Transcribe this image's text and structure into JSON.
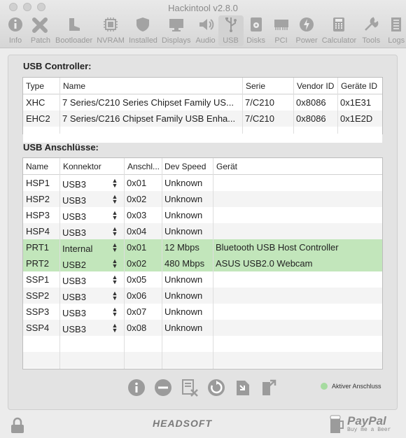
{
  "window": {
    "title": "Hackintool v2.8.0"
  },
  "toolbar": [
    {
      "label": "Info",
      "icon": "info-icon"
    },
    {
      "label": "Patch",
      "icon": "patch-icon"
    },
    {
      "label": "Bootloader",
      "icon": "boot-icon"
    },
    {
      "label": "NVRAM",
      "icon": "chip-icon"
    },
    {
      "label": "Installed",
      "icon": "shield-icon"
    },
    {
      "label": "Displays",
      "icon": "display-icon"
    },
    {
      "label": "Audio",
      "icon": "speaker-icon"
    },
    {
      "label": "USB",
      "icon": "usb-icon",
      "active": true
    },
    {
      "label": "Disks",
      "icon": "disk-icon"
    },
    {
      "label": "PCI",
      "icon": "pci-icon"
    },
    {
      "label": "Power",
      "icon": "power-icon"
    },
    {
      "label": "Calculator",
      "icon": "calculator-icon"
    },
    {
      "label": "Tools",
      "icon": "tools-icon"
    },
    {
      "label": "Logs",
      "icon": "logs-icon"
    }
  ],
  "controller": {
    "title": "USB Controller:",
    "headers": {
      "type": "Type",
      "name": "Name",
      "serie": "Serie",
      "vendor": "Vendor ID",
      "device": "Geräte ID"
    },
    "rows": [
      {
        "type": "XHC",
        "name": "7 Series/C210 Series Chipset Family US...",
        "serie": "7/C210",
        "vendor": "0x8086",
        "device": "0x1E31"
      },
      {
        "type": "EHC2",
        "name": "7 Series/C216 Chipset Family USB Enha...",
        "serie": "7/C210",
        "vendor": "0x8086",
        "device": "0x1E2D"
      }
    ]
  },
  "ports": {
    "title": "USB Anschlüsse:",
    "headers": {
      "name": "Name",
      "connector": "Konnektor",
      "port": "Anschl...",
      "speed": "Dev Speed",
      "device": "Gerät"
    },
    "rows": [
      {
        "name": "HSP1",
        "connector": "USB3",
        "port": "0x01",
        "speed": "Unknown",
        "device": "",
        "active": false
      },
      {
        "name": "HSP2",
        "connector": "USB3",
        "port": "0x02",
        "speed": "Unknown",
        "device": "",
        "active": false
      },
      {
        "name": "HSP3",
        "connector": "USB3",
        "port": "0x03",
        "speed": "Unknown",
        "device": "",
        "active": false
      },
      {
        "name": "HSP4",
        "connector": "USB3",
        "port": "0x04",
        "speed": "Unknown",
        "device": "",
        "active": false
      },
      {
        "name": "PRT1",
        "connector": "Internal",
        "port": "0x01",
        "speed": "12 Mbps",
        "device": "Bluetooth USB Host Controller",
        "active": true
      },
      {
        "name": "PRT2",
        "connector": "USB2",
        "port": "0x02",
        "speed": "480 Mbps",
        "device": "ASUS USB2.0 Webcam",
        "active": true
      },
      {
        "name": "SSP1",
        "connector": "USB3",
        "port": "0x05",
        "speed": "Unknown",
        "device": "",
        "active": false
      },
      {
        "name": "SSP2",
        "connector": "USB3",
        "port": "0x06",
        "speed": "Unknown",
        "device": "",
        "active": false
      },
      {
        "name": "SSP3",
        "connector": "USB3",
        "port": "0x07",
        "speed": "Unknown",
        "device": "",
        "active": false
      },
      {
        "name": "SSP4",
        "connector": "USB3",
        "port": "0x08",
        "speed": "Unknown",
        "device": "",
        "active": false
      }
    ]
  },
  "actions": [
    {
      "name": "info-button",
      "icon": "info-icon"
    },
    {
      "name": "remove-button",
      "icon": "minus-icon"
    },
    {
      "name": "clear-button",
      "icon": "clear-icon"
    },
    {
      "name": "refresh-button",
      "icon": "refresh-icon"
    },
    {
      "name": "import-button",
      "icon": "import-icon"
    },
    {
      "name": "export-button",
      "icon": "export-icon"
    }
  ],
  "legend": {
    "label": "Aktiver Anschluss",
    "color": "#a6dba0"
  },
  "footer": {
    "brand": "HEADSOFT",
    "paypal": "PayPal",
    "paypal_sub": "Buy me a Beer"
  },
  "colors": {
    "active_row": "#c2e6bb",
    "accent": "#9a9a9a"
  }
}
